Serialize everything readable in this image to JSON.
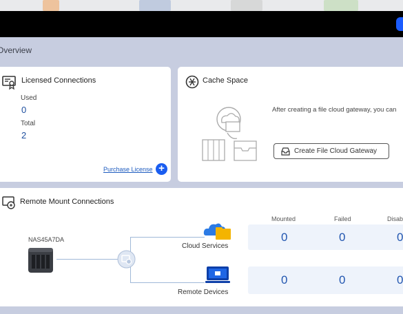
{
  "overview": {
    "title": "Overview"
  },
  "licensed": {
    "title": "Licensed Connections",
    "used_label": "Used",
    "used_value": "0",
    "total_label": "Total",
    "total_value": "2",
    "purchase_link": "Purchase License"
  },
  "cache": {
    "title": "Cache Space",
    "message": "After creating a file cloud gateway, you can",
    "button_label": "Create File Cloud Gateway"
  },
  "remote": {
    "title": "Remote Mount Connections",
    "nas_name": "NAS45A7DA",
    "headers": {
      "mounted": "Mounted",
      "failed": "Failed",
      "disabled": "Disab"
    },
    "cloud": {
      "label": "Cloud Services",
      "mounted": "0",
      "failed": "0",
      "disabled": "0"
    },
    "devices": {
      "label": "Remote Devices",
      "mounted": "0",
      "failed": "0",
      "disabled": "0"
    }
  },
  "colors": {
    "accent": "#1a5df0",
    "number": "#2256b0",
    "background": "#c7cde0"
  }
}
